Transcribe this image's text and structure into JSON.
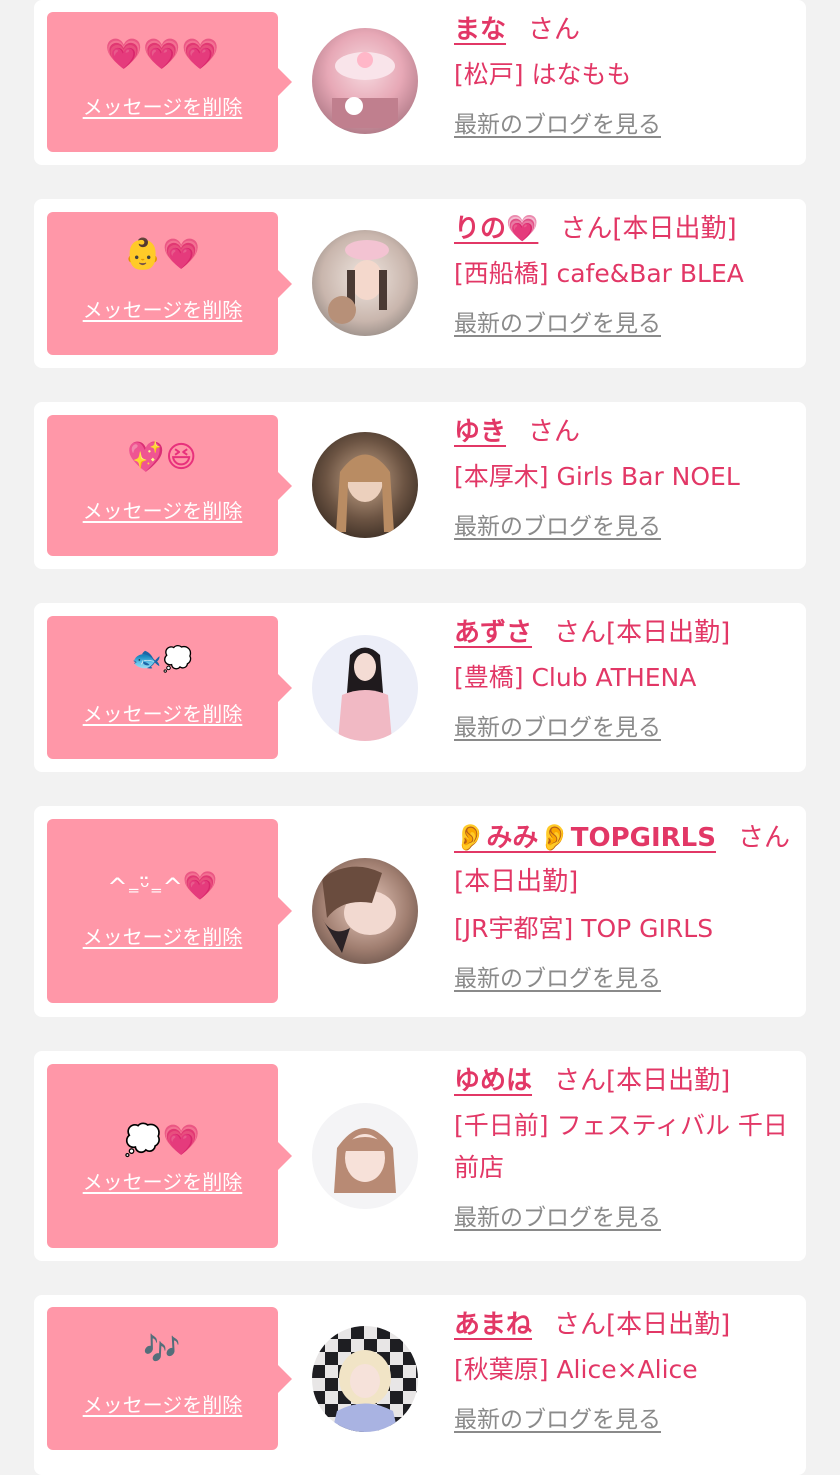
{
  "delete_label": "メッセージを削除",
  "blog_label": "最新のブログを見る",
  "san_label": "さん",
  "entries": [
    {
      "emoji": "💗💗💗",
      "name": "まな",
      "status": "",
      "shop": "[松戸] はなもも"
    },
    {
      "emoji": "👶💗",
      "name": "りの💗",
      "status": "[本日出勤]",
      "shop": "[西船橋] cafe&Bar BLEA"
    },
    {
      "emoji": "💖😆",
      "name": "ゆき",
      "status": "",
      "shop": "[本厚木] Girls Bar NOEL"
    },
    {
      "emoji": "🐟💭",
      "name": "あずさ",
      "status": "[本日出勤]",
      "shop": "[豊橋] Club ATHENA"
    },
    {
      "emoji_text": "^₌ᵕ̈₌^",
      "emoji_heart": "💗",
      "name": "👂みみ👂TOPGIRLS",
      "status": "[本日出勤]",
      "shop": "[JR宇都宮] TOP GIRLS"
    },
    {
      "emoji": "💭💗",
      "name": "ゆめは",
      "status": "[本日出勤]",
      "shop": "[千日前] フェスティバル 千日前店"
    },
    {
      "emoji": "🎶",
      "name": "あまね",
      "status": "[本日出勤]",
      "shop": "[秋葉原] Alice×Alice"
    }
  ],
  "colors": {
    "accent": "#e23766",
    "bubble": "#ff97a8",
    "background": "#f2f2f2",
    "link_gray": "#8a8a8a"
  }
}
